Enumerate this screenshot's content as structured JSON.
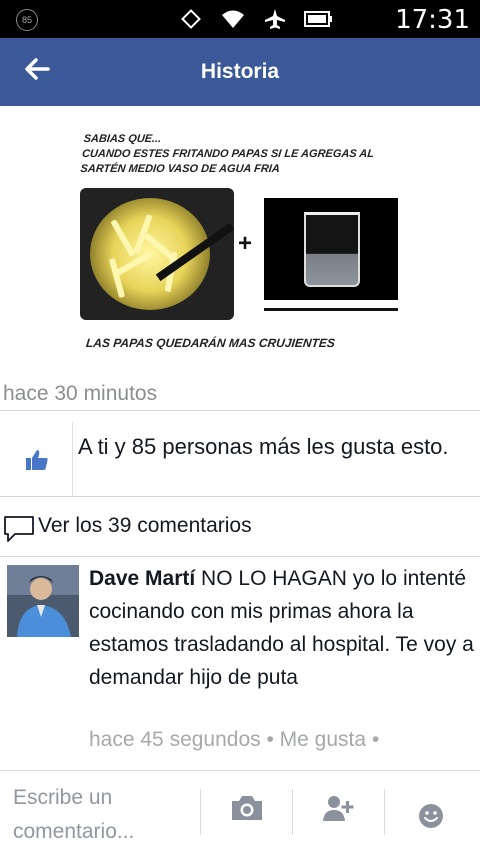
{
  "status_bar": {
    "badge": "85",
    "time": "17:31"
  },
  "app_bar": {
    "title": "Historia",
    "back_icon": "arrow-left-icon"
  },
  "post": {
    "image_text": {
      "line1": "SABIAS QUE...",
      "line2": "CUANDO ESTES FRITANDO PAPAS SI LE AGREGAS AL",
      "line3": "SARTÉN MEDIO VASO DE AGUA FRIA",
      "plus": "+",
      "bottom": "LAS PAPAS QUEDARÁN MAS CRUJIENTES"
    },
    "timestamp": "hace 30 minutos",
    "likes_text": "A ti y 85 personas más les gusta esto.",
    "comments_link": "Ver los 39 comentarios"
  },
  "comment": {
    "author": "Dave Martí",
    "text": " NO LO HAGAN yo lo intenté cocinando con mis primas ahora la estamos trasladando al hospital. Te voy a demandar hijo de puta",
    "meta": "hace 45 segundos • Me gusta •"
  },
  "footer": {
    "placeholder": "Escribe un comentario..."
  },
  "colors": {
    "brand": "#3b5998",
    "like_blue": "#4a76c8",
    "meta_gray": "#8b8d90"
  }
}
